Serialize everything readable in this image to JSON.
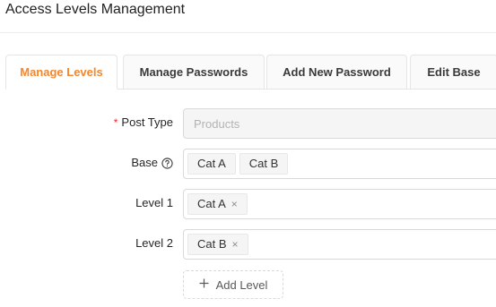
{
  "page": {
    "title": "Access Levels Management"
  },
  "tabs": [
    {
      "label": "Manage Levels",
      "active": true
    },
    {
      "label": "Manage Passwords",
      "active": false
    },
    {
      "label": "Add New Password",
      "active": false
    },
    {
      "label": "Edit Base",
      "active": false
    }
  ],
  "form": {
    "post_type": {
      "label": "Post Type",
      "required_mark": "*",
      "placeholder": "Products"
    },
    "base": {
      "label": "Base",
      "help_icon": "question-circle-icon",
      "tags": [
        "Cat A",
        "Cat B"
      ]
    },
    "level1": {
      "label": "Level 1",
      "tags": [
        "Cat A"
      ],
      "close_glyph": "×"
    },
    "level2": {
      "label": "Level 2",
      "tags": [
        "Cat B"
      ],
      "close_glyph": "×"
    },
    "add_level": {
      "label": "Add Level",
      "icon": "plus-icon"
    }
  },
  "colors": {
    "accent": "#f7862a",
    "required": "#f5222d"
  }
}
